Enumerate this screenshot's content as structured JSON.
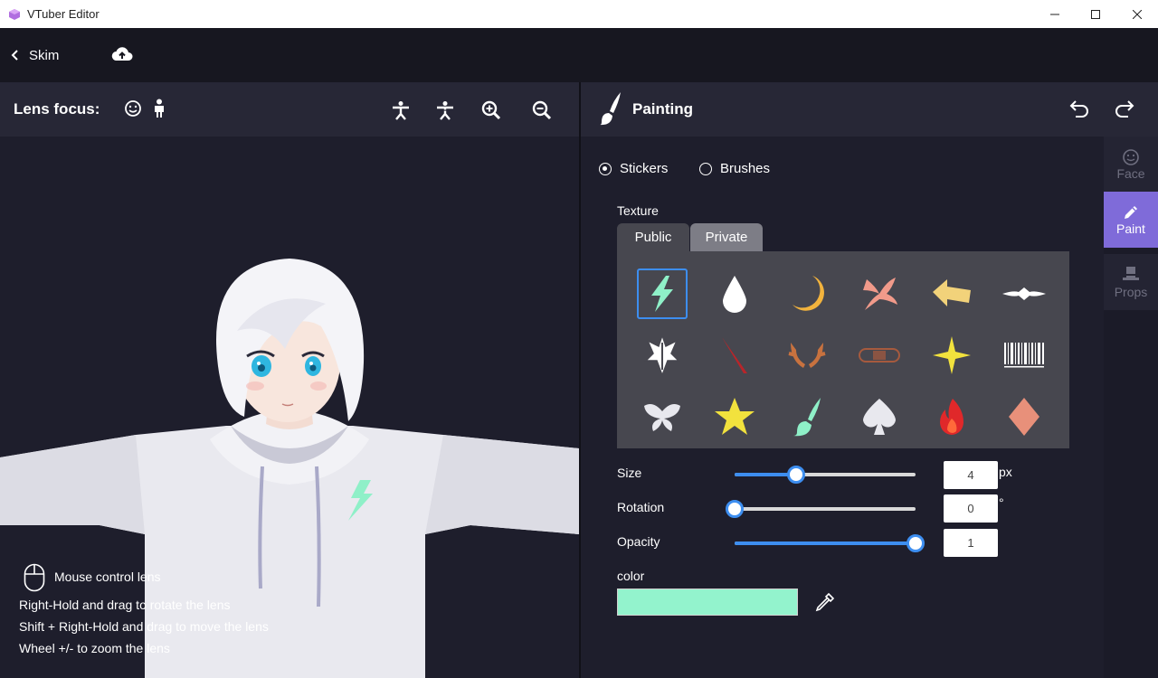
{
  "window": {
    "title": "VTuber Editor"
  },
  "nav": {
    "back_label": "Skim"
  },
  "lens": {
    "label": "Lens focus:"
  },
  "painting": {
    "title": "Painting"
  },
  "mode": {
    "stickers_label": "Stickers",
    "brushes_label": "Brushes",
    "selected": "Stickers"
  },
  "texture": {
    "label": "Texture",
    "tabs": [
      "Public",
      "Private"
    ],
    "active_tab": "Public"
  },
  "stickers": [
    {
      "name": "lightning-sticker",
      "color": "#8ff0c8"
    },
    {
      "name": "drop-sticker",
      "color": "#ffffff"
    },
    {
      "name": "moon-sticker",
      "color": "#f2b33d"
    },
    {
      "name": "dragon-sticker",
      "color": "#f19a8a"
    },
    {
      "name": "arrow-sticker",
      "color": "#f2d27a"
    },
    {
      "name": "tribal-sticker",
      "color": "#ffffff"
    },
    {
      "name": "crest-sticker",
      "color": "#ffffff"
    },
    {
      "name": "slash-sticker",
      "color": "#b8252a"
    },
    {
      "name": "antlers-sticker",
      "color": "#c8723f"
    },
    {
      "name": "bandage-sticker",
      "color": "#a65a3e"
    },
    {
      "name": "sparkle-sticker",
      "color": "#f2e23d"
    },
    {
      "name": "barcode-sticker",
      "color": "#ffffff"
    },
    {
      "name": "butterfly-sticker",
      "color": "#e8e8ee"
    },
    {
      "name": "star-sticker",
      "color": "#f2e23d"
    },
    {
      "name": "brush-sticker",
      "color": "#8ff0c8"
    },
    {
      "name": "spade-sticker",
      "color": "#e8e8ee"
    },
    {
      "name": "flame-sticker",
      "color": "#e0282a"
    },
    {
      "name": "diamond-sticker",
      "color": "#e8907a"
    }
  ],
  "controls": {
    "size": {
      "label": "Size",
      "value": "4",
      "unit": "px",
      "fraction": 0.34
    },
    "rotation": {
      "label": "Rotation",
      "value": "0",
      "unit": "°",
      "fraction": 0.0
    },
    "opacity": {
      "label": "Opacity",
      "value": "1",
      "unit": "",
      "fraction": 1.0
    }
  },
  "color": {
    "label": "color",
    "value": "#93f3cd"
  },
  "side_tabs": [
    {
      "label": "Face",
      "icon": "smiley-icon",
      "active": false
    },
    {
      "label": "Paint",
      "icon": "pencil-icon",
      "active": true
    },
    {
      "label": "Props",
      "icon": "hat-icon",
      "active": false
    }
  ],
  "help": {
    "title": "Mouse control lens",
    "lines": [
      "Right-Hold and drag to rotate the lens",
      "Shift + Right-Hold and drag to move the lens",
      "Wheel +/- to zoom the lens"
    ]
  },
  "colors": {
    "accent": "#3d8ef0",
    "active_tab": "#7f6bd9"
  }
}
